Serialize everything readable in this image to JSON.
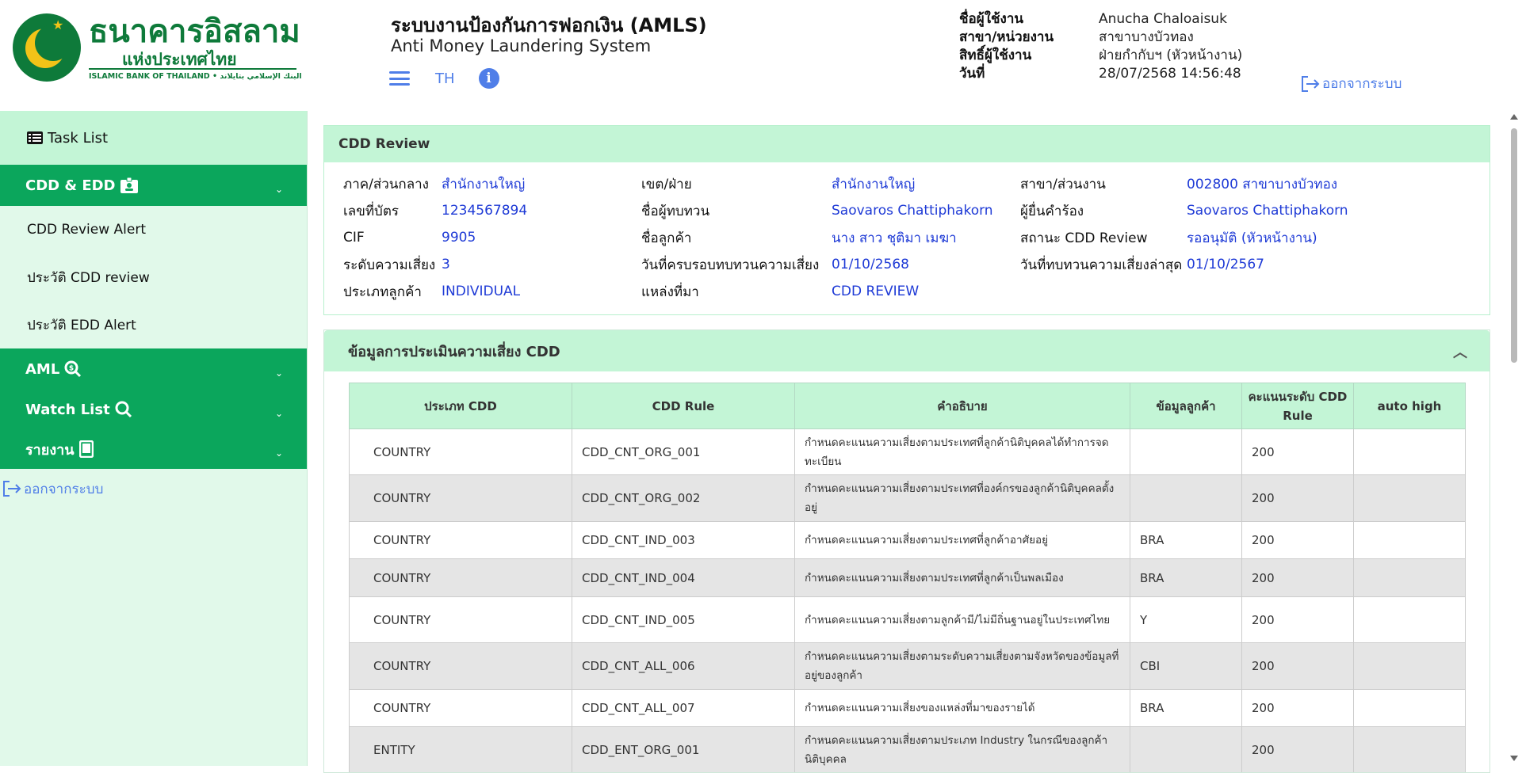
{
  "logo": {
    "name_th": "ธนาคารอิสลาม",
    "name_th2": "แห่งประเทศไทย",
    "name_en": "ISLAMIC BANK OF THAILAND • البنك الإسلامي بتايلاند"
  },
  "header": {
    "title": "ระบบงานป้องกันการฟอกเงิน (AMLS)",
    "subtitle": "Anti Money Laundering System",
    "lang": "TH",
    "user": [
      {
        "label": "ชื่อผู้ใช้งาน",
        "value": "Anucha Chaloaisuk"
      },
      {
        "label": "สาขา/หน่วยงาน",
        "value": "สาขาบางบัวทอง"
      },
      {
        "label": "สิทธิ์ผู้ใช้งาน",
        "value": "ฝ่ายกำกับฯ (หัวหน้างาน)"
      },
      {
        "label": "วันที่",
        "value": "28/07/2568 14:56:48"
      }
    ],
    "logout": "ออกจากระบบ"
  },
  "sidebar": {
    "task_list": "Task List",
    "groups": [
      {
        "label": "CDD & EDD",
        "icon": "id-badge-icon"
      },
      {
        "label": "AML",
        "icon": "search-money-icon"
      },
      {
        "label": "Watch List",
        "icon": "search-icon"
      },
      {
        "label": "รายงาน",
        "icon": "tablet-icon"
      }
    ],
    "cdd_items": [
      "CDD Review Alert",
      "ประวัติ CDD review",
      "ประวัติ EDD Alert"
    ],
    "logout": "ออกจากระบบ"
  },
  "cdd_review": {
    "title": "CDD Review",
    "rows": [
      [
        {
          "label": "ภาค/ส่วนกลาง",
          "value": "สำนักงานใหญ่"
        },
        {
          "label": "เขต/ฝ่าย",
          "value": "สำนักงานใหญ่"
        },
        {
          "label": "สาขา/ส่วนงาน",
          "value": "002800 สาขาบางบัวทอง"
        }
      ],
      [
        {
          "label": "เลขที่บัตร",
          "value": "1234567894"
        },
        {
          "label": "ชื่อผู้ทบทวน",
          "value": "Saovaros Chattiphakorn"
        },
        {
          "label": "ผู้ยื่นคำร้อง",
          "value": "Saovaros Chattiphakorn"
        }
      ],
      [
        {
          "label": "CIF",
          "value": "9905"
        },
        {
          "label": "ชื่อลูกค้า",
          "value": "นาง สาว ชุติมา เมฆา"
        },
        {
          "label": "สถานะ CDD Review",
          "value": "รออนุมัติ (หัวหน้างาน)"
        }
      ],
      [
        {
          "label": "ระดับความเสี่ยง",
          "value": "3"
        },
        {
          "label": "วันที่ครบรอบทบทวนความเสี่ยง",
          "value": "01/10/2568"
        },
        {
          "label": "วันที่ทบทวนความเสี่ยงล่าสุด",
          "value": "01/10/2567"
        }
      ],
      [
        {
          "label": "ประเภทลูกค้า",
          "value": "INDIVIDUAL"
        },
        {
          "label": "แหล่งที่มา",
          "value": "CDD REVIEW"
        }
      ]
    ]
  },
  "risk": {
    "title": "ข้อมูลการประเมินความเสี่ยง CDD",
    "columns": [
      "ประเภท CDD",
      "CDD Rule",
      "คำอธิบาย",
      "ข้อมูลลูกค้า",
      "คะแนนระดับ CDD Rule",
      "auto high"
    ],
    "rows": [
      [
        "COUNTRY",
        "CDD_CNT_ORG_001",
        "กำหนดคะแนนความเสี่ยงตามประเทศที่ลูกค้านิติบุคคลได้ทำการจดทะเบียน",
        "",
        "200",
        ""
      ],
      [
        "COUNTRY",
        "CDD_CNT_ORG_002",
        "กำหนดคะแนนความเสี่ยงตามประเทศที่องค์กรของลูกค้านิติบุคคลตั้งอยู่",
        "",
        "200",
        ""
      ],
      [
        "COUNTRY",
        "CDD_CNT_IND_003",
        "กำหนดคะแนนความเสี่ยงตามประเทศที่ลูกค้าอาศัยอยู่",
        "BRA",
        "200",
        ""
      ],
      [
        "COUNTRY",
        "CDD_CNT_IND_004",
        "กำหนดคะแนนความเสี่ยงตามประเทศที่ลูกค้าเป็นพลเมือง",
        "BRA",
        "200",
        ""
      ],
      [
        "COUNTRY",
        "CDD_CNT_IND_005",
        "กำหนดคะแนนความเสี่ยงตามลูกค้ามี/ไม่มีถิ่นฐานอยู่ในประเทศไทย",
        "Y",
        "200",
        ""
      ],
      [
        "COUNTRY",
        "CDD_CNT_ALL_006",
        "กำหนดคะแนนความเสี่ยงตามระดับความเสี่ยงตามจังหวัดของข้อมูลที่อยู่ของลูกค้า",
        "CBI",
        "200",
        ""
      ],
      [
        "COUNTRY",
        "CDD_CNT_ALL_007",
        "กำหนดคะแนนความเสี่ยงของแหล่งที่มาของรายได้",
        "BRA",
        "200",
        ""
      ],
      [
        "ENTITY",
        "CDD_ENT_ORG_001",
        "กำหนดคะแนนความเสี่ยงตามประเภท Industry ในกรณีของลูกค้านิติบุคคล",
        "",
        "200",
        ""
      ]
    ]
  }
}
